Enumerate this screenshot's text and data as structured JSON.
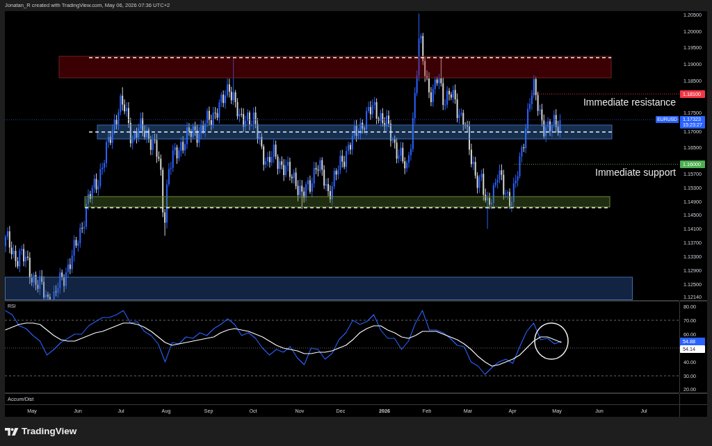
{
  "header": {
    "credit": "Jonatan_R created with TradingView.com, May 06, 2026 07:36 UTC+2"
  },
  "price_pane": {
    "levels": [
      {
        "label": "Immediate resistance",
        "price_tag": "1.18100",
        "color": "#f23645"
      },
      {
        "label": "Immediate support",
        "price_tag": "1.16000",
        "color": "#4caf50"
      }
    ],
    "symbol_tag": {
      "symbol": "EURUSD",
      "price": "1.17323",
      "countdown": "15:23:27"
    },
    "price_axis": {
      "ticks": [
        "1.20500",
        "1.20000",
        "1.19500",
        "1.19000",
        "1.18500",
        "1.17500",
        "1.17000",
        "1.16500",
        "1.15700",
        "1.15300",
        "1.14900",
        "1.14500",
        "1.14100",
        "1.13700",
        "1.13300",
        "1.12900",
        "1.12500",
        "1.12140"
      ]
    }
  },
  "rsi_pane": {
    "title": "RSI",
    "value_tags": [
      {
        "text": "54.88"
      },
      {
        "text": "54.14"
      }
    ],
    "chart_data": {
      "type": "line",
      "ylim": [
        18,
        83.5
      ],
      "yticks": [
        {
          "value": 80,
          "label": "80.00"
        },
        {
          "value": 70,
          "label": "70.00"
        },
        {
          "value": 60,
          "label": "60.00"
        },
        {
          "value": 40,
          "label": "40.00"
        },
        {
          "value": 30,
          "label": "30.00"
        },
        {
          "value": 20,
          "label": "20.00"
        }
      ],
      "series": [
        {
          "color": "#2962ff",
          "values": [
            77,
            74,
            66,
            64,
            59,
            55,
            45,
            49,
            54,
            57,
            60,
            60,
            66,
            69,
            72,
            72,
            74,
            77,
            68,
            69,
            62,
            59,
            53,
            40,
            54,
            53,
            58,
            57,
            61,
            59,
            64,
            67,
            71,
            67,
            59,
            61,
            57,
            50,
            45,
            49,
            47,
            51,
            43,
            38,
            50,
            49,
            42,
            46,
            56,
            61,
            70,
            67,
            69,
            74,
            63,
            57,
            57,
            49,
            55,
            68,
            77,
            63,
            63,
            61,
            57,
            52,
            51,
            40,
            37,
            31,
            36,
            40,
            42,
            39,
            51,
            62,
            68,
            56,
            57,
            53,
            55
          ]
        },
        {
          "color": "#ffffff",
          "values": [
            63,
            65,
            67,
            68,
            68,
            67,
            63,
            59,
            56,
            55,
            55,
            57,
            59,
            61,
            62,
            64,
            66,
            68,
            68,
            67,
            65,
            62,
            58,
            54,
            52,
            53,
            54,
            55,
            56,
            57,
            58,
            61,
            63,
            64,
            63,
            62,
            60,
            58,
            55,
            52,
            50,
            49,
            48,
            46,
            46,
            47,
            47,
            48,
            50,
            52,
            56,
            61,
            64,
            66,
            66,
            63,
            61,
            58,
            57,
            59,
            62,
            62,
            62,
            60,
            58,
            56,
            53,
            49,
            44,
            40,
            37,
            38,
            40,
            42,
            45,
            50,
            55,
            58,
            58,
            56,
            54
          ]
        }
      ]
    }
  },
  "accum_dist_pane": {
    "title": "Accum/Dist"
  },
  "time_axis": {
    "labels": [
      {
        "text": "May",
        "kind": "month"
      },
      {
        "text": "Jun",
        "kind": "month"
      },
      {
        "text": "Jul",
        "kind": "month"
      },
      {
        "text": "Aug",
        "kind": "month"
      },
      {
        "text": "Sep",
        "kind": "month"
      },
      {
        "text": "Oct",
        "kind": "month"
      },
      {
        "text": "Nov",
        "kind": "month"
      },
      {
        "text": "Dec",
        "kind": "month"
      },
      {
        "text": "2026",
        "kind": "year"
      },
      {
        "text": "Feb",
        "kind": "month"
      },
      {
        "text": "Mar",
        "kind": "month"
      },
      {
        "text": "Apr",
        "kind": "month"
      },
      {
        "text": "May",
        "kind": "month"
      },
      {
        "text": "Jun",
        "kind": "month"
      },
      {
        "text": "Jul",
        "kind": "month"
      }
    ]
  },
  "footer": {
    "brand": "TradingView"
  }
}
